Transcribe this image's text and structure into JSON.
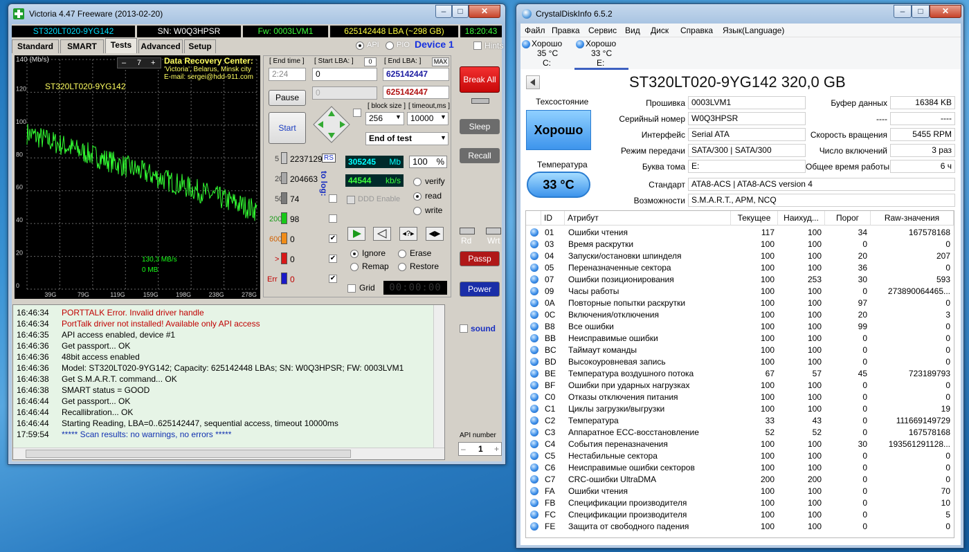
{
  "colors": {
    "good_blue": "#3d94ec",
    "graph_line": "#33ff33",
    "break_red": "#e81010"
  },
  "victoria": {
    "title": "Victoria 4.47  Freeware (2013-02-20)",
    "info": {
      "model": "ST320LT020-9YG142",
      "serial": "SN: W0Q3HPSR",
      "fw": "Fw: 0003LVM1",
      "capacity": "625142448 LBA (~298 GB)",
      "clock": "18:20:43"
    },
    "tabs": [
      "Standard",
      "SMART",
      "Tests",
      "Advanced",
      "Setup"
    ],
    "api_label": "API",
    "pio_label": "PIO",
    "device": "Device 1",
    "hints": "Hints",
    "graph": {
      "ymax": "140 (Mb/s)",
      "ticks_y": [
        "120",
        "100",
        "80",
        "60",
        "40",
        "20",
        "0"
      ],
      "ticks_x": [
        "39G",
        "79G",
        "119G",
        "159G",
        "198G",
        "238G",
        "278G"
      ],
      "model": "ST320LT020-9YG142",
      "speed": "130,3 MB/s",
      "mb": "0 MB",
      "spin_value": "7"
    },
    "drc": {
      "title": "Data Recovery Center:",
      "line2": "'Victoria', Belarus, Minsk city",
      "email": "E-mail: sergei@hdd-911.com"
    },
    "end_time_label": "[ End time ]",
    "end_time": "2:24",
    "start_lba_label": "[ Start LBA: ]",
    "start_lba": "0",
    "start_lba_aux": "0",
    "end_lba_label": "[ End LBA: ]",
    "end_lba_max": "MAX",
    "end_lba": "625142447",
    "end_lba2": "625142447",
    "pause": "Pause",
    "start": "Start",
    "block_label": "[ block size ]",
    "block": "256",
    "timeout_label": "[ timeout,ms ]",
    "timeout": "10000",
    "end_mode": "End of test",
    "break_all": "Break All",
    "sleep": "Sleep",
    "recall": "Recall",
    "passp": "Passp",
    "power": "Power",
    "rs": "RS",
    "to_log": "to log:",
    "bins": [
      {
        "label": "5",
        "count": "2237129"
      },
      {
        "label": "20",
        "count": "204663"
      },
      {
        "label": "50",
        "count": "74"
      },
      {
        "label": "200",
        "count": "98"
      },
      {
        "label": "600",
        "count": "0"
      },
      {
        "label": ">",
        "count": "0"
      },
      {
        "label": "Err",
        "count": "0"
      }
    ],
    "mb_value": "305245",
    "mb_unit": "Mb",
    "percent": "100",
    "percent_unit": "%",
    "kbs_value": "44544",
    "kbs_unit": "kb/s",
    "ddd": "DDD Enable",
    "verify": "verify",
    "read": "read",
    "write": "write",
    "ignore": "Ignore",
    "erase": "Erase",
    "remap": "Remap",
    "restore": "Restore",
    "grid": "Grid",
    "timer": "00:00:00",
    "rd": "Rd",
    "wrt": "Wrt",
    "sound": "sound",
    "api_number_label": "API number",
    "api_number": "1",
    "log": [
      {
        "time": "16:46:34",
        "text": "PORTTALK Error. Invalid driver handle",
        "color": "#c00000"
      },
      {
        "time": "16:46:34",
        "text": "PortTalk driver not installed! Available only API access",
        "color": "#c00000"
      },
      {
        "time": "16:46:35",
        "text": "API access enabled, device #1",
        "color": "#000"
      },
      {
        "time": "16:46:36",
        "text": "Get passport... OK",
        "color": "#000"
      },
      {
        "time": "16:46:36",
        "text": "48bit access enabled",
        "color": "#000"
      },
      {
        "time": "16:46:36",
        "text": "Model: ST320LT020-9YG142; Capacity: 625142448 LBAs; SN: W0Q3HPSR; FW: 0003LVM1",
        "color": "#000"
      },
      {
        "time": "16:46:38",
        "text": "Get S.M.A.R.T. command... OK",
        "color": "#000"
      },
      {
        "time": "16:46:38",
        "text": "SMART status = GOOD",
        "color": "#000"
      },
      {
        "time": "16:46:44",
        "text": "Get passport... OK",
        "color": "#000"
      },
      {
        "time": "16:46:44",
        "text": "Recallibration... OK",
        "color": "#000"
      },
      {
        "time": "16:46:44",
        "text": "Starting Reading, LBA=0..625142447, sequential access, timeout 10000ms",
        "color": "#000"
      },
      {
        "time": "17:59:54",
        "text": "***** Scan results: no warnings, no errors *****",
        "color": "#1030b0"
      }
    ]
  },
  "crystal": {
    "title": "CrystalDiskInfo 6.5.2",
    "menu": [
      "Файл",
      "Правка",
      "Сервис",
      "Вид",
      "Диск",
      "Справка",
      "Язык(Language)"
    ],
    "drives": [
      {
        "status": "Хорошо",
        "temp": "35 °C",
        "letter": "C:"
      },
      {
        "status": "Хорошо",
        "temp": "33 °C",
        "letter": "E:"
      }
    ],
    "model": "ST320LT020-9YG142 320,0 GB",
    "health_label": "Техсостояние",
    "health": "Хорошо",
    "temp_label": "Температура",
    "temp": "33 °C",
    "left_fields": [
      {
        "label": "Прошивка",
        "value": "0003LVM1"
      },
      {
        "label": "Серийный номер",
        "value": "W0Q3HPSR"
      },
      {
        "label": "Интерфейс",
        "value": "Serial ATA"
      },
      {
        "label": "Режим передачи",
        "value": "SATA/300 | SATA/300"
      },
      {
        "label": "Буква тома",
        "value": "E:"
      }
    ],
    "right_fields": [
      {
        "label": "Буфер данных",
        "value": "16384 KB"
      },
      {
        "label": "----",
        "value": "----"
      },
      {
        "label": "Скорость вращения",
        "value": "5455 RPM"
      },
      {
        "label": "Число включений",
        "value": "3 раз"
      },
      {
        "label": "Общее время работы",
        "value": "6 ч"
      }
    ],
    "standard_label": "Стандарт",
    "standard": "ATA8-ACS | ATA8-ACS version 4",
    "features_label": "Возможности",
    "features": "S.M.A.R.T., APM, NCQ",
    "smart_headers": [
      "ID",
      "Атрибут",
      "Текущее",
      "Наихуд...",
      "Порог",
      "Raw-значения"
    ],
    "smart": [
      [
        "01",
        "Ошибки чтения",
        "117",
        "100",
        "34",
        "167578168"
      ],
      [
        "03",
        "Время раскрутки",
        "100",
        "100",
        "0",
        "0"
      ],
      [
        "04",
        "Запуски/остановки шпинделя",
        "100",
        "100",
        "20",
        "207"
      ],
      [
        "05",
        "Переназначенные сектора",
        "100",
        "100",
        "36",
        "0"
      ],
      [
        "07",
        "Ошибки позиционирования",
        "100",
        "253",
        "30",
        "593"
      ],
      [
        "09",
        "Часы работы",
        "100",
        "100",
        "0",
        "273890064465..."
      ],
      [
        "0A",
        "Повторные попытки раскрутки",
        "100",
        "100",
        "97",
        "0"
      ],
      [
        "0C",
        "Включения/отключения",
        "100",
        "100",
        "20",
        "3"
      ],
      [
        "B8",
        "Все ошибки",
        "100",
        "100",
        "99",
        "0"
      ],
      [
        "BB",
        "Неисправимые ошибки",
        "100",
        "100",
        "0",
        "0"
      ],
      [
        "BC",
        "Таймаут команды",
        "100",
        "100",
        "0",
        "0"
      ],
      [
        "BD",
        "Высокоуровневая запись",
        "100",
        "100",
        "0",
        "0"
      ],
      [
        "BE",
        "Температура воздушного потока",
        "67",
        "57",
        "45",
        "723189793"
      ],
      [
        "BF",
        "Ошибки при ударных нагрузках",
        "100",
        "100",
        "0",
        "0"
      ],
      [
        "C0",
        "Отказы отключения питания",
        "100",
        "100",
        "0",
        "0"
      ],
      [
        "C1",
        "Циклы загрузки/выгрузки",
        "100",
        "100",
        "0",
        "19"
      ],
      [
        "C2",
        "Температура",
        "33",
        "43",
        "0",
        "111669149729"
      ],
      [
        "C3",
        "Аппаратное ECC-восстановление",
        "52",
        "52",
        "0",
        "167578168"
      ],
      [
        "C4",
        "События переназначения",
        "100",
        "100",
        "30",
        "193561291128..."
      ],
      [
        "C5",
        "Нестабильные сектора",
        "100",
        "100",
        "0",
        "0"
      ],
      [
        "C6",
        "Неисправимые ошибки секторов",
        "100",
        "100",
        "0",
        "0"
      ],
      [
        "C7",
        "CRC-ошибки UltraDMA",
        "200",
        "200",
        "0",
        "0"
      ],
      [
        "FA",
        "Ошибки чтения",
        "100",
        "100",
        "0",
        "70"
      ],
      [
        "FB",
        "Спецификации производителя",
        "100",
        "100",
        "0",
        "10"
      ],
      [
        "FC",
        "Спецификации производителя",
        "100",
        "100",
        "0",
        "5"
      ],
      [
        "FE",
        "Защита от свободного падения",
        "100",
        "100",
        "0",
        "0"
      ]
    ]
  }
}
